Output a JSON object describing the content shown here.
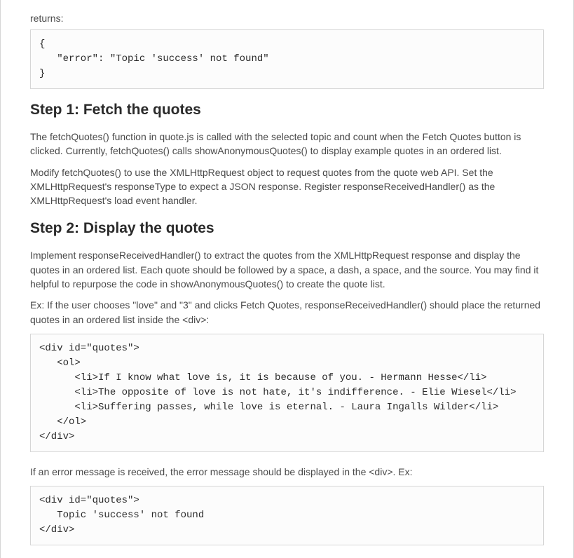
{
  "intro": {
    "returns_label": "returns:",
    "code_error": "{\n   \"error\": \"Topic 'success' not found\"\n}"
  },
  "step1": {
    "heading": "Step 1: Fetch the quotes",
    "p1": "The fetchQuotes() function in quote.js is called with the selected topic and count when the Fetch Quotes button is clicked. Currently, fetchQuotes() calls showAnonymousQuotes() to display example quotes in an ordered list.",
    "p2": "Modify fetchQuotes() to use the XMLHttpRequest object to request quotes from the quote web API. Set the XMLHttpRequest's responseType to expect a JSON response. Register responseReceivedHandler() as the XMLHttpRequest's load event handler."
  },
  "step2": {
    "heading": "Step 2: Display the quotes",
    "p1": "Implement responseReceivedHandler() to extract the quotes from the XMLHttpRequest response and display the quotes in an ordered list. Each quote should be followed by a space, a dash, a space, and the source. You may find it helpful to repurpose the code in showAnonymousQuotes() to create the quote list.",
    "p2": "Ex: If the user chooses \"love\" and \"3\" and clicks Fetch Quotes, responseReceivedHandler() should place the returned quotes in an ordered list inside the <div>:",
    "code_example": "<div id=\"quotes\">\n   <ol>\n      <li>If I know what love is, it is because of you. - Hermann Hesse</li>\n      <li>The opposite of love is not hate, it's indifference. - Elie Wiesel</li>\n      <li>Suffering passes, while love is eternal. - Laura Ingalls Wilder</li>\n   </ol>\n</div>",
    "p3": "If an error message is received, the error message should be displayed in the <div>. Ex:",
    "code_error_example": "<div id=\"quotes\">\n   Topic 'success' not found\n</div>"
  }
}
